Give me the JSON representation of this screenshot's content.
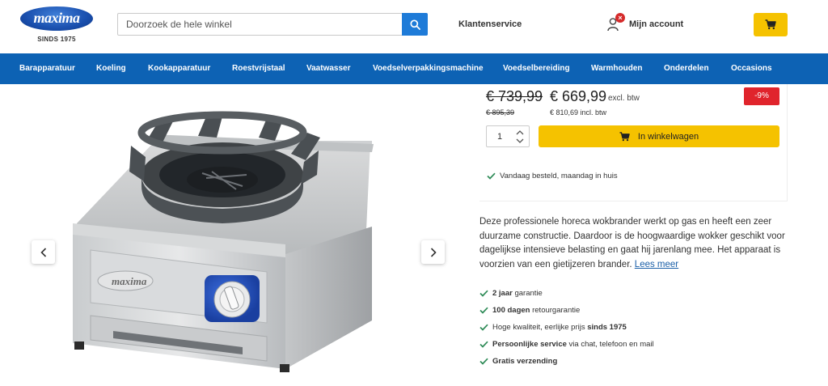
{
  "header": {
    "logo_text": "maxima",
    "logo_sub": "SINDS 1975",
    "search_placeholder": "Doorzoek de hele winkel",
    "service_label": "Klantenservice",
    "account_label": "Mijn account",
    "account_badge": "×"
  },
  "nav": {
    "items": [
      "Barapparatuur",
      "Koeling",
      "Kookapparatuur",
      "Roestvrijstaal",
      "Vaatwasser",
      "Voedselverpakkingsmachine",
      "Voedselbereiding",
      "Warmhouden",
      "Onderdelen",
      "Occasions"
    ]
  },
  "product": {
    "image_brand": "maxima",
    "price_old": "€ 739,99",
    "price_new": "€ 669,99",
    "excl_label": "excl. btw",
    "old_incl": "€ 895,39",
    "new_incl": "€ 810,69 incl. btw",
    "discount": "-9%",
    "quantity": "1",
    "add_to_cart": "In winkelwagen",
    "delivery": "Vandaag besteld, maandag in huis",
    "description_text": "Deze professionele horeca wokbrander werkt op gas en heeft een zeer duurzame constructie. Daardoor is de hoogwaardige wokker geschikt voor dagelijkse intensieve belasting en gaat hij jarenlang mee. Het apparaat is voorzien van een gietijzeren brander.",
    "read_more": "Lees meer"
  },
  "usps": [
    {
      "bold": "2 jaar",
      "text": " garantie"
    },
    {
      "bold": "100 dagen",
      "text": " retourgarantie"
    },
    {
      "pre": "Hoge kwaliteit, eerlijke prijs ",
      "bold": "sinds 1975"
    },
    {
      "bold": "Persoonlijke service",
      "text": " via chat, telefoon en mail"
    },
    {
      "bold": "Gratis verzending",
      "text": ""
    }
  ],
  "colors": {
    "nav_blue": "#0d62b4",
    "accent_yellow": "#f5c200",
    "discount_red": "#e0242c",
    "check_green": "#2e8b57"
  }
}
